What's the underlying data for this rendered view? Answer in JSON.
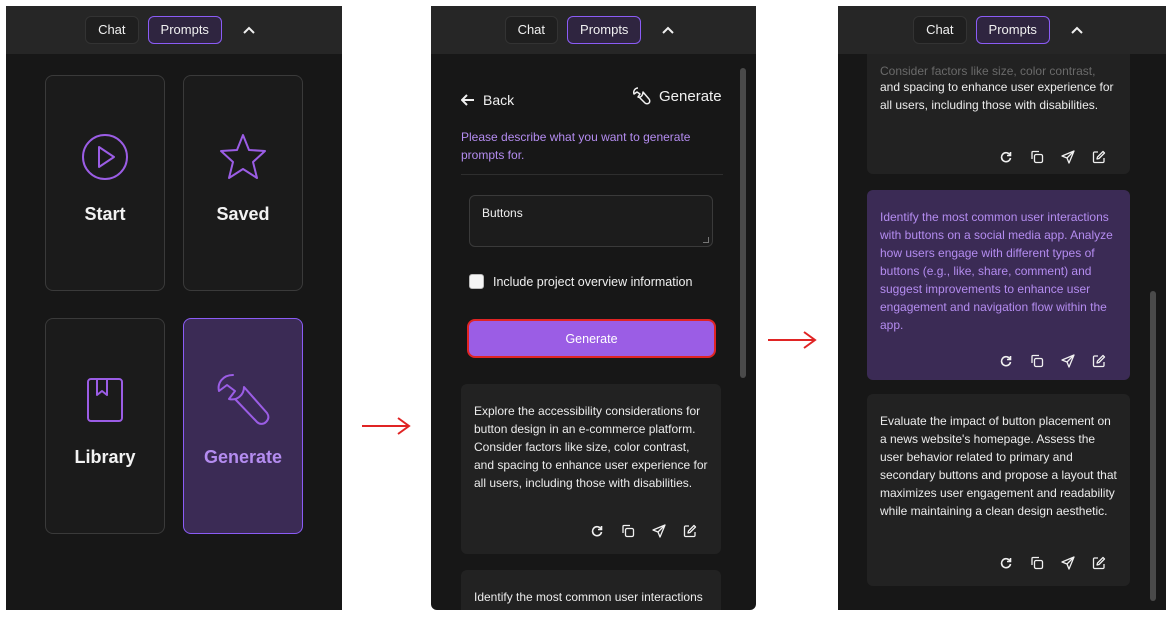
{
  "nav": {
    "chat_label": "Chat",
    "prompts_label": "Prompts"
  },
  "home": {
    "tiles": [
      {
        "label": "Start",
        "icon": "play-circle-icon"
      },
      {
        "label": "Saved",
        "icon": "star-icon"
      },
      {
        "label": "Library",
        "icon": "bookmark-icon"
      },
      {
        "label": "Generate",
        "icon": "wrench-icon"
      }
    ]
  },
  "generate": {
    "back_label": "Back",
    "title": "Generate",
    "description": "Please describe what you want to generate prompts for.",
    "input_value": "Buttons",
    "checkbox_label": "Include project overview information",
    "button_label": "Generate"
  },
  "results": [
    {
      "text": "Explore the accessibility considerations for button design in an e-commerce platform. Consider factors like size, color contrast, and spacing to enhance user experience for all users, including those with disabilities."
    },
    {
      "text": "Identify the most common user interactions with buttons on a social media app. Analyze how users engage with different types of buttons (e.g., like, share, comment) and suggest improvements to enhance user engagement and navigation flow within the app."
    },
    {
      "text": "Evaluate the impact of button placement on a news website's homepage. Assess the user behavior related to primary and secondary buttons and propose a layout that maximizes user engagement and readability while maintaining a clean design aesthetic."
    }
  ],
  "partial": {
    "top_card_tail": "and spacing to enhance user experience for all users, including those with disabilities.",
    "top_card_clipped": "Consider factors like size, color contrast,",
    "bottom_card_head": "Identify the most common user interactions"
  },
  "colors": {
    "accent": "#9b5de5",
    "highlight": "#e02424",
    "panel": "#171717"
  }
}
